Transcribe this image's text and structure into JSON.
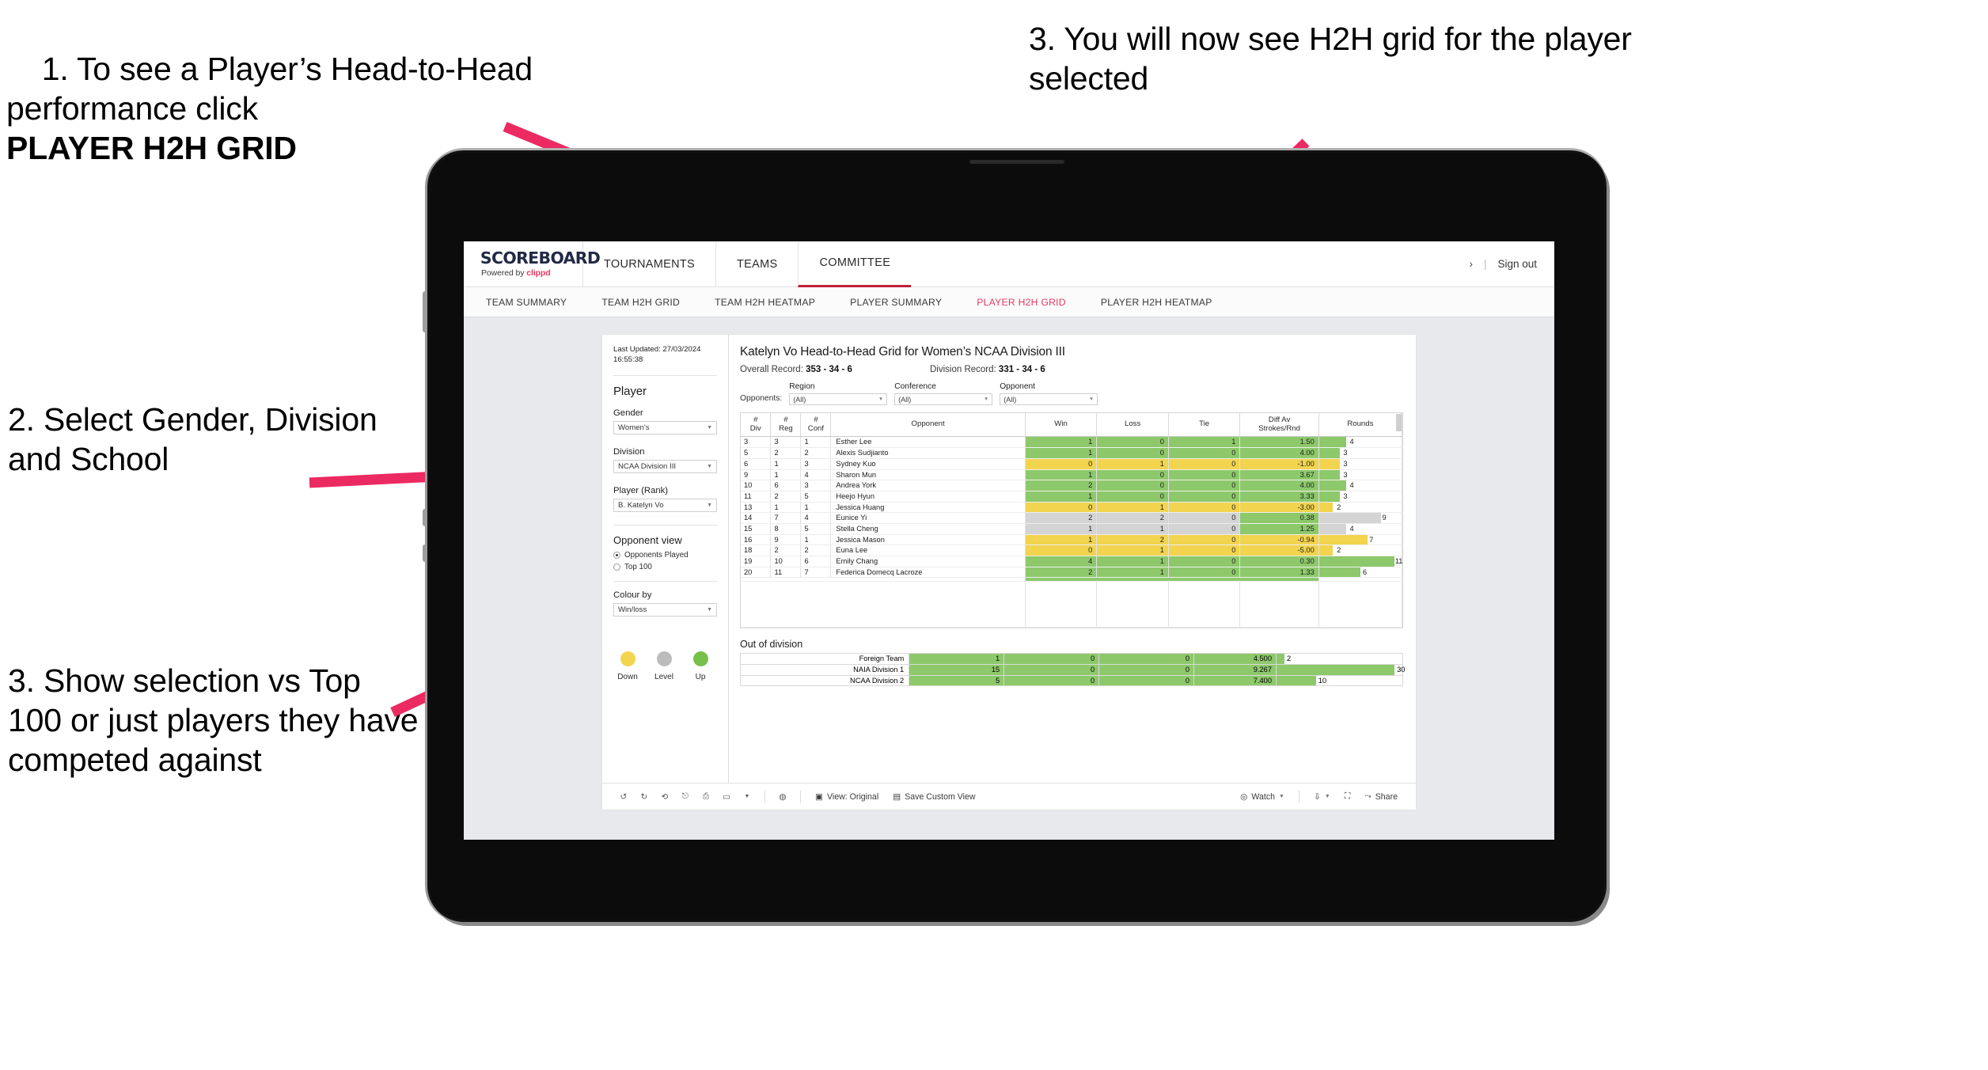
{
  "annotations": {
    "a1_line1": "1. To see a Player’s Head-",
    "a1_line2": "to-Head performance click ",
    "a1_strong": "PLAYER H2H GRID",
    "a2": "2. Select Gender, Division and School",
    "a3": "3. Show selection vs Top 100 or just players they have competed against",
    "a4": "3. You will now see H2H grid for the player selected",
    "arrow_color": "#ec2a62"
  },
  "topbar": {
    "logo": "SCOREBOARD",
    "powered_prefix": "Powered by ",
    "powered_brand": "clippd",
    "nav": [
      {
        "label": "TOURNAMENTS",
        "active": false
      },
      {
        "label": "TEAMS",
        "active": false
      },
      {
        "label": "COMMITTEE",
        "active": true
      }
    ],
    "account_chevron": "›",
    "separator": "|",
    "sign_out": "Sign out"
  },
  "subnav": {
    "items": [
      {
        "label": "TEAM SUMMARY",
        "active": false
      },
      {
        "label": "TEAM H2H GRID",
        "active": false
      },
      {
        "label": "TEAM H2H HEATMAP",
        "active": false
      },
      {
        "label": "PLAYER SUMMARY",
        "active": false
      },
      {
        "label": "PLAYER H2H GRID",
        "active": true
      },
      {
        "label": "PLAYER H2H HEATMAP",
        "active": false
      }
    ]
  },
  "panel": {
    "last_updated_line1": "Last Updated: 27/03/2024",
    "last_updated_line2": "16:55:38",
    "player_heading": "Player",
    "gender_label": "Gender",
    "gender_value": "Women's",
    "division_label": "Division",
    "division_value": "NCAA Division III",
    "player_rank_label": "Player (Rank)",
    "player_rank_value": "B. Katelyn Vo",
    "opponent_view_heading": "Opponent view",
    "opponent_view_options": [
      {
        "label": "Opponents Played",
        "selected": true
      },
      {
        "label": "Top 100",
        "selected": false
      }
    ],
    "colour_by_label": "Colour by",
    "colour_by_value": "Win/loss",
    "legend": [
      {
        "label": "Down",
        "color": "#f2d44e"
      },
      {
        "label": "Level",
        "color": "#bcbcbc"
      },
      {
        "label": "Up",
        "color": "#77c04b"
      }
    ]
  },
  "content": {
    "title": "Katelyn Vo Head-to-Head Grid for Women’s NCAA Division III",
    "overall_record_label": "Overall Record: ",
    "overall_record_value": "353 -  34 - 6",
    "division_record_label": "Division Record: ",
    "division_record_value": "331 - 34 - 6",
    "opponents_label": "Opponents:",
    "filters": [
      {
        "label": "Region",
        "value": "(All)"
      },
      {
        "label": "Conference",
        "value": "(All)"
      },
      {
        "label": "Opponent",
        "value": "(All)"
      }
    ]
  },
  "chart_data": {
    "type": "table",
    "title": "Katelyn Vo Head-to-Head Grid for Women’s NCAA Division III",
    "columns": [
      "# Div",
      "# Reg",
      "# Conf",
      "Opponent",
      "Win",
      "Loss",
      "Tie",
      "Diff Av Strokes/Rnd",
      "Rounds"
    ],
    "column_headers_multiline": [
      [
        "#",
        "Div"
      ],
      [
        "#",
        "Reg"
      ],
      [
        "#",
        "Conf"
      ],
      [
        "Opponent"
      ],
      [
        "Win"
      ],
      [
        "Loss"
      ],
      [
        "Tie"
      ],
      [
        "Diff Av",
        "Strokes/Rnd"
      ],
      [
        "Rounds"
      ]
    ],
    "rounds_max": 12,
    "colors": {
      "up": "#8dc96a",
      "down": "#f2d44e",
      "level": "#d4d4d4"
    },
    "rows": [
      {
        "div": "3",
        "reg": "3",
        "conf": "1",
        "opponent": "Esther Lee",
        "win": "1",
        "loss": "0",
        "tie": "1",
        "diff": "1.50",
        "rounds": "4",
        "state": "up"
      },
      {
        "div": "5",
        "reg": "2",
        "conf": "2",
        "opponent": "Alexis Sudjianto",
        "win": "1",
        "loss": "0",
        "tie": "0",
        "diff": "4.00",
        "rounds": "3",
        "state": "up"
      },
      {
        "div": "6",
        "reg": "1",
        "conf": "3",
        "opponent": "Sydney Kuo",
        "win": "0",
        "loss": "1",
        "tie": "0",
        "diff": "-1.00",
        "rounds": "3",
        "state": "down"
      },
      {
        "div": "9",
        "reg": "1",
        "conf": "4",
        "opponent": "Sharon Mun",
        "win": "1",
        "loss": "0",
        "tie": "0",
        "diff": "3.67",
        "rounds": "3",
        "state": "up"
      },
      {
        "div": "10",
        "reg": "6",
        "conf": "3",
        "opponent": "Andrea York",
        "win": "2",
        "loss": "0",
        "tie": "0",
        "diff": "4.00",
        "rounds": "4",
        "state": "up"
      },
      {
        "div": "11",
        "reg": "2",
        "conf": "5",
        "opponent": "Heejo Hyun",
        "win": "1",
        "loss": "0",
        "tie": "0",
        "diff": "3.33",
        "rounds": "3",
        "state": "up"
      },
      {
        "div": "13",
        "reg": "1",
        "conf": "1",
        "opponent": "Jessica Huang",
        "win": "0",
        "loss": "1",
        "tie": "0",
        "diff": "-3.00",
        "rounds": "2",
        "state": "down"
      },
      {
        "div": "14",
        "reg": "7",
        "conf": "4",
        "opponent": "Eunice Yi",
        "win": "2",
        "loss": "2",
        "tie": "0",
        "diff": "0.38",
        "rounds": "9",
        "state": "level",
        "diff_state": "up"
      },
      {
        "div": "15",
        "reg": "8",
        "conf": "5",
        "opponent": "Stella Cheng",
        "win": "1",
        "loss": "1",
        "tie": "0",
        "diff": "1.25",
        "rounds": "4",
        "state": "level",
        "diff_state": "up"
      },
      {
        "div": "16",
        "reg": "9",
        "conf": "1",
        "opponent": "Jessica Mason",
        "win": "1",
        "loss": "2",
        "tie": "0",
        "diff": "-0.94",
        "rounds": "7",
        "state": "down"
      },
      {
        "div": "18",
        "reg": "2",
        "conf": "2",
        "opponent": "Euna Lee",
        "win": "0",
        "loss": "1",
        "tie": "0",
        "diff": "-5.00",
        "rounds": "2",
        "state": "down"
      },
      {
        "div": "19",
        "reg": "10",
        "conf": "6",
        "opponent": "Emily Chang",
        "win": "4",
        "loss": "1",
        "tie": "0",
        "diff": "0.30",
        "rounds": "11",
        "state": "up"
      },
      {
        "div": "20",
        "reg": "11",
        "conf": "7",
        "opponent": "Federica Domecq Lacroze",
        "win": "2",
        "loss": "1",
        "tie": "0",
        "diff": "1.33",
        "rounds": "6",
        "state": "up"
      }
    ],
    "out_of_division_title": "Out of division",
    "out_of_division_max": 32,
    "out_of_division": [
      {
        "label": "Foreign Team",
        "win": "1",
        "loss": "0",
        "tie": "0",
        "diff": "4.500",
        "rounds": "2",
        "state": "up"
      },
      {
        "label": "NAIA Division 1",
        "win": "15",
        "loss": "0",
        "tie": "0",
        "diff": "9.267",
        "rounds": "30",
        "state": "up"
      },
      {
        "label": "NCAA Division 2",
        "win": "5",
        "loss": "0",
        "tie": "0",
        "diff": "7.400",
        "rounds": "10",
        "state": "up"
      }
    ]
  },
  "toolbar": {
    "view_label": "View: Original",
    "save_custom_view": "Save Custom View",
    "watch": "Watch",
    "share": "Share"
  }
}
